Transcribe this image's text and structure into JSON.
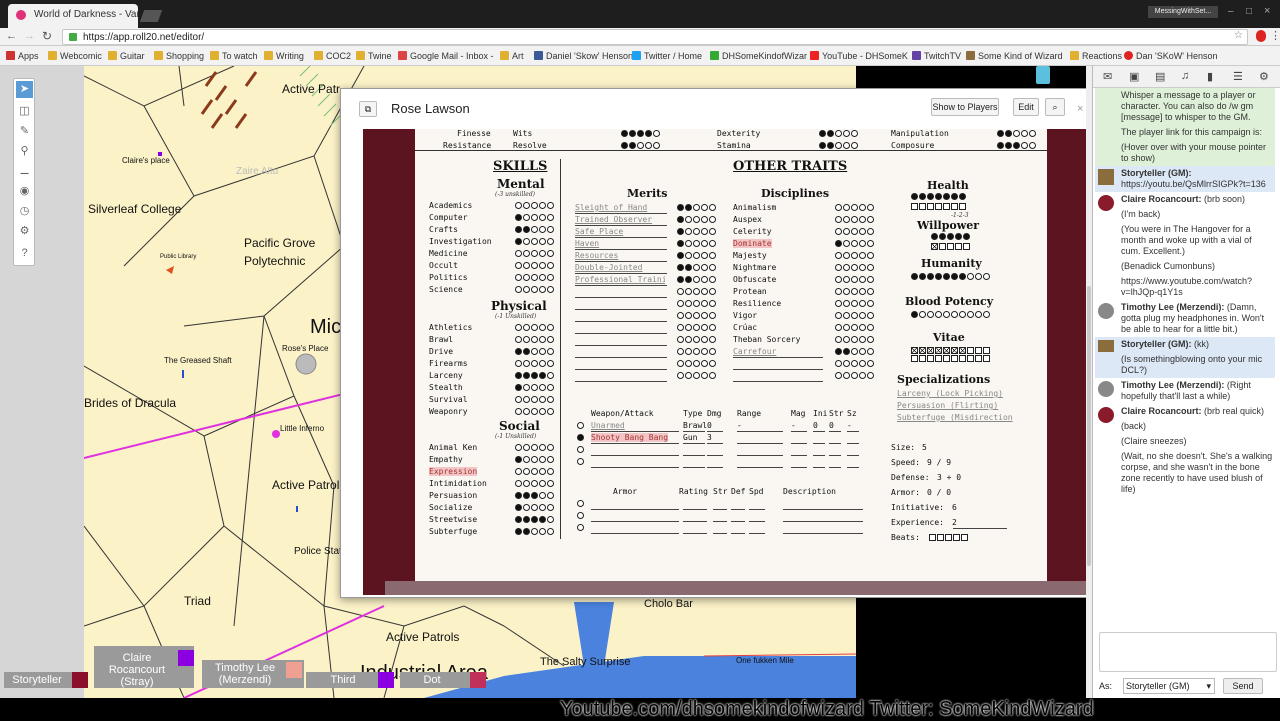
{
  "browser": {
    "tabs": [
      {
        "title": "World of Darkness - Vam"
      }
    ],
    "profile_label": "MessingWithSet...",
    "url": "https://app.roll20.net/editor/",
    "bookmarks": [
      "Apps",
      "Webcomic",
      "Guitar",
      "Shopping",
      "To watch",
      "Writing",
      "COC2",
      "Twine",
      "Google Mail - Inbox -",
      "Art",
      "Daniel 'Skow' Henson",
      "Twitter / Home",
      "DHSomeKindofWizar",
      "YouTube - DHSomeK",
      "TwitchTV",
      "Some Kind of Wizard",
      "Reactions",
      "Dan 'SKoW' Henson"
    ]
  },
  "map": {
    "labels": [
      "Active Patr",
      "Claire's place",
      "Zaire Altu",
      "Silverleaf College",
      "Public Library",
      "Pacific Grove",
      "Polytechnic",
      "Mic",
      "Rose's Place",
      "The Greased Shaft",
      "Brides of Dracula",
      "Little Inferno",
      "Active Patrol",
      "Police Stat",
      "Triad",
      "Active Patrols",
      "Industrial Area",
      "The Salty Surprise",
      "Cholo Bar",
      "One fukken Mile"
    ]
  },
  "players": [
    {
      "name": "Storyteller",
      "color": "#8b0f2a"
    },
    {
      "name": "Claire Rocancourt (Stray)",
      "color": "#8a00e0"
    },
    {
      "name": "Timothy Lee (Merzendi)",
      "color": "#f0a090"
    },
    {
      "name": "Third",
      "color": "#8a00e0"
    },
    {
      "name": "Dot",
      "color": "#c0305a"
    }
  ],
  "sheet": {
    "title": "Rose Lawson",
    "buttons": {
      "show": "Show to Players",
      "edit": "Edit",
      "search": "⌕"
    },
    "top_rows": [
      {
        "l1": "Finesse",
        "a": "Wits",
        "av": 4,
        "b": "Dexterity",
        "bv": 2,
        "c": "Manipulation",
        "cv": 2
      },
      {
        "l1": "Resistance",
        "a": "Resolve",
        "av": 2,
        "b": "Stamina",
        "bv": 2,
        "c": "Composure",
        "cv": 3
      }
    ],
    "skills_title": "SKILLS",
    "mental_title": "Mental",
    "mental_sub": "(-3 unskilled)",
    "mental": [
      [
        "Academics",
        0
      ],
      [
        "Computer",
        1
      ],
      [
        "Crafts",
        2
      ],
      [
        "Investigation",
        1
      ],
      [
        "Medicine",
        0
      ],
      [
        "Occult",
        0
      ],
      [
        "Politics",
        0
      ],
      [
        "Science",
        0
      ]
    ],
    "physical_title": "Physical",
    "physical_sub": "(-1 Unskilled)",
    "physical": [
      [
        "Athletics",
        0
      ],
      [
        "Brawl",
        0
      ],
      [
        "Drive",
        2
      ],
      [
        "Firearms",
        0
      ],
      [
        "Larceny",
        4
      ],
      [
        "Stealth",
        1
      ],
      [
        "Survival",
        0
      ],
      [
        "Weaponry",
        0
      ]
    ],
    "social_title": "Social",
    "social_sub": "(-1 Unskilled)",
    "social": [
      [
        "Animal Ken",
        0
      ],
      [
        "Empathy",
        1
      ],
      [
        "Expression",
        0
      ],
      [
        "Intimidation",
        0
      ],
      [
        "Persuasion",
        3
      ],
      [
        "Socialize",
        1
      ],
      [
        "Streetwise",
        4
      ],
      [
        "Subterfuge",
        2
      ]
    ],
    "other_title": "OTHER TRAITS",
    "merits_title": "Merits",
    "merits": [
      [
        "Sleight of Hand",
        2
      ],
      [
        "Trained Observer",
        1
      ],
      [
        "Safe Place",
        1
      ],
      [
        "Haven",
        1
      ],
      [
        "Resources",
        1
      ],
      [
        "Double-Jointed",
        2
      ],
      [
        "Professional Traini",
        2
      ]
    ],
    "disciplines_title": "Disciplines",
    "disciplines": [
      [
        "Animalism",
        0
      ],
      [
        "Auspex",
        0
      ],
      [
        "Celerity",
        0
      ],
      [
        "Dominate",
        1
      ],
      [
        "Majesty",
        0
      ],
      [
        "Nightmare",
        0
      ],
      [
        "Obfuscate",
        0
      ],
      [
        "Protean",
        0
      ],
      [
        "Resilience",
        0
      ],
      [
        "Vigor",
        0
      ],
      [
        "Crúac",
        0
      ],
      [
        "Theban Sorcery",
        0
      ],
      [
        "Carrefour",
        2
      ]
    ],
    "health_title": "Health",
    "health_sub": "-1-2-3",
    "willpower_title": "Willpower",
    "humanity_title": "Humanity",
    "bp_title": "Blood Potency",
    "vitae_title": "Vitae",
    "spec_title": "Specializations",
    "specs": [
      "Larceny (Lock Picking)",
      "Persuasion (Flirting)",
      "Subterfuge (Misdirection"
    ],
    "weapon_head": {
      "w": "Weapon/Attack",
      "t": "Type",
      "d": "Dmg",
      "r": "Range",
      "m": "Mag",
      "i": "Ini",
      "s": "Str",
      "z": "Sz"
    },
    "weapons": [
      {
        "name": "Unarmed",
        "type": "Brawl",
        "dmg": "0",
        "range": "-",
        "mag": "-",
        "ini": "0",
        "str": "0",
        "sz": "-"
      },
      {
        "name": "Shooty Bang Bang",
        "type": "Gun",
        "dmg": "3",
        "range": "",
        "mag": "",
        "ini": "",
        "str": "",
        "sz": ""
      }
    ],
    "armor_head": {
      "a": "Armor",
      "r": "Rating",
      "s": "Str",
      "d": "Def",
      "p": "Spd",
      "x": "Description"
    },
    "stats": [
      [
        "Size:",
        "5"
      ],
      [
        "Speed:",
        "9 / 9"
      ],
      [
        "Defense:",
        "3 + 0"
      ],
      [
        "Armor:",
        "0 / 0"
      ],
      [
        "Initiative:",
        "6"
      ],
      [
        "Experience:",
        "2"
      ],
      [
        "Beats:",
        ""
      ]
    ]
  },
  "chat": {
    "messages": [
      {
        "type": "sys",
        "text": "Whisper a message to a player or character. You can also do /w gm [message] to whisper to the GM."
      },
      {
        "type": "sys",
        "text": "The player link for this campaign is:"
      },
      {
        "type": "sys",
        "text": "(Hover over with your mouse pointer to show)"
      },
      {
        "type": "gm",
        "who": "Storyteller (GM):",
        "text": "https://youtu.be/QsMlrrSIGPk?t=136"
      },
      {
        "type": "cl",
        "who": "Claire Rocancourt:",
        "text": "(brb soon)"
      },
      {
        "type": "cl",
        "who": "",
        "text": "(I'm back)"
      },
      {
        "type": "cl",
        "who": "",
        "text": "(You were in The Hangover for a month and woke up with a vial of cum. Excellent.)"
      },
      {
        "type": "cl",
        "who": "",
        "text": "(Benadick Cumonbuns)"
      },
      {
        "type": "cl",
        "who": "",
        "text": "https://www.youtube.com/watch?v=lhJQp-q1Y1s"
      },
      {
        "type": "tl",
        "who": "Timothy Lee (Merzendi):",
        "text": "(Damn, gotta plug my headphones in. Won't be able to hear for a little bit.)"
      },
      {
        "type": "gm",
        "who": "Storyteller (GM):",
        "text": "(kk)"
      },
      {
        "type": "gm",
        "who": "",
        "text": "(Is somethingblowing onto your mic DCL?)"
      },
      {
        "type": "tl",
        "who": "Timothy Lee (Merzendi):",
        "text": "(Right hopefully that'll last a while)"
      },
      {
        "type": "cl",
        "who": "Claire Rocancourt:",
        "text": "(brb real quick)"
      },
      {
        "type": "cl",
        "who": "",
        "text": "(back)"
      },
      {
        "type": "cl",
        "who": "",
        "text": "(Claire sneezes)"
      },
      {
        "type": "cl",
        "who": "",
        "text": "(Wait, no she doesn't. She's a walking corpse, and she wasn't in the bone zone recently to have used blush of life)"
      }
    ],
    "as_label": "As:",
    "as_value": "Storyteller (GM)",
    "send_label": "Send"
  },
  "overlay": {
    "text": "Youtube.com/dhsomekindofwizard    Twitter: SomeKindWizard"
  }
}
